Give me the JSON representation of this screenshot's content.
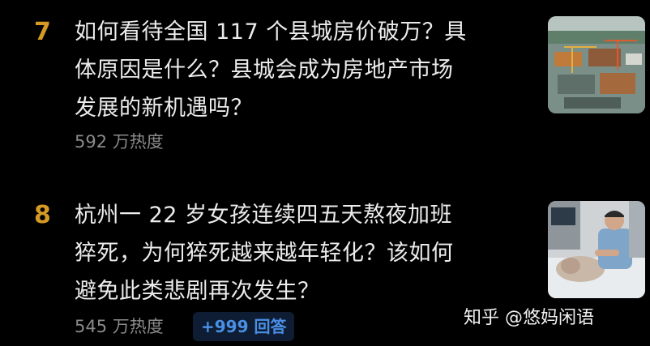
{
  "items": [
    {
      "rank": "7",
      "title_lines": [
        "如何看待全国 117 个县城房价破万？具",
        "体原因是什么？县城会成为房地产市场",
        "发展的新机遇吗？"
      ],
      "heat": "592 万热度",
      "thumbnail": "construction-site-thumbnail"
    },
    {
      "rank": "8",
      "title_lines": [
        "杭州一 22 岁女孩连续四五天熬夜加班",
        "猝死，为何猝死越来越年轻化？该如何",
        "避免此类悲剧再次发生？"
      ],
      "heat": "545 万热度",
      "answers_badge": "+999 回答",
      "thumbnail": "hospital-patient-thumbnail"
    }
  ],
  "watermark": "知乎 @悠妈闲语",
  "colors": {
    "background": "#000000",
    "rank": "#d49a24",
    "title": "#ececec",
    "meta": "#8a8a8a",
    "badge_bg": "#0e1d33",
    "badge_text": "#4a8fe6"
  }
}
